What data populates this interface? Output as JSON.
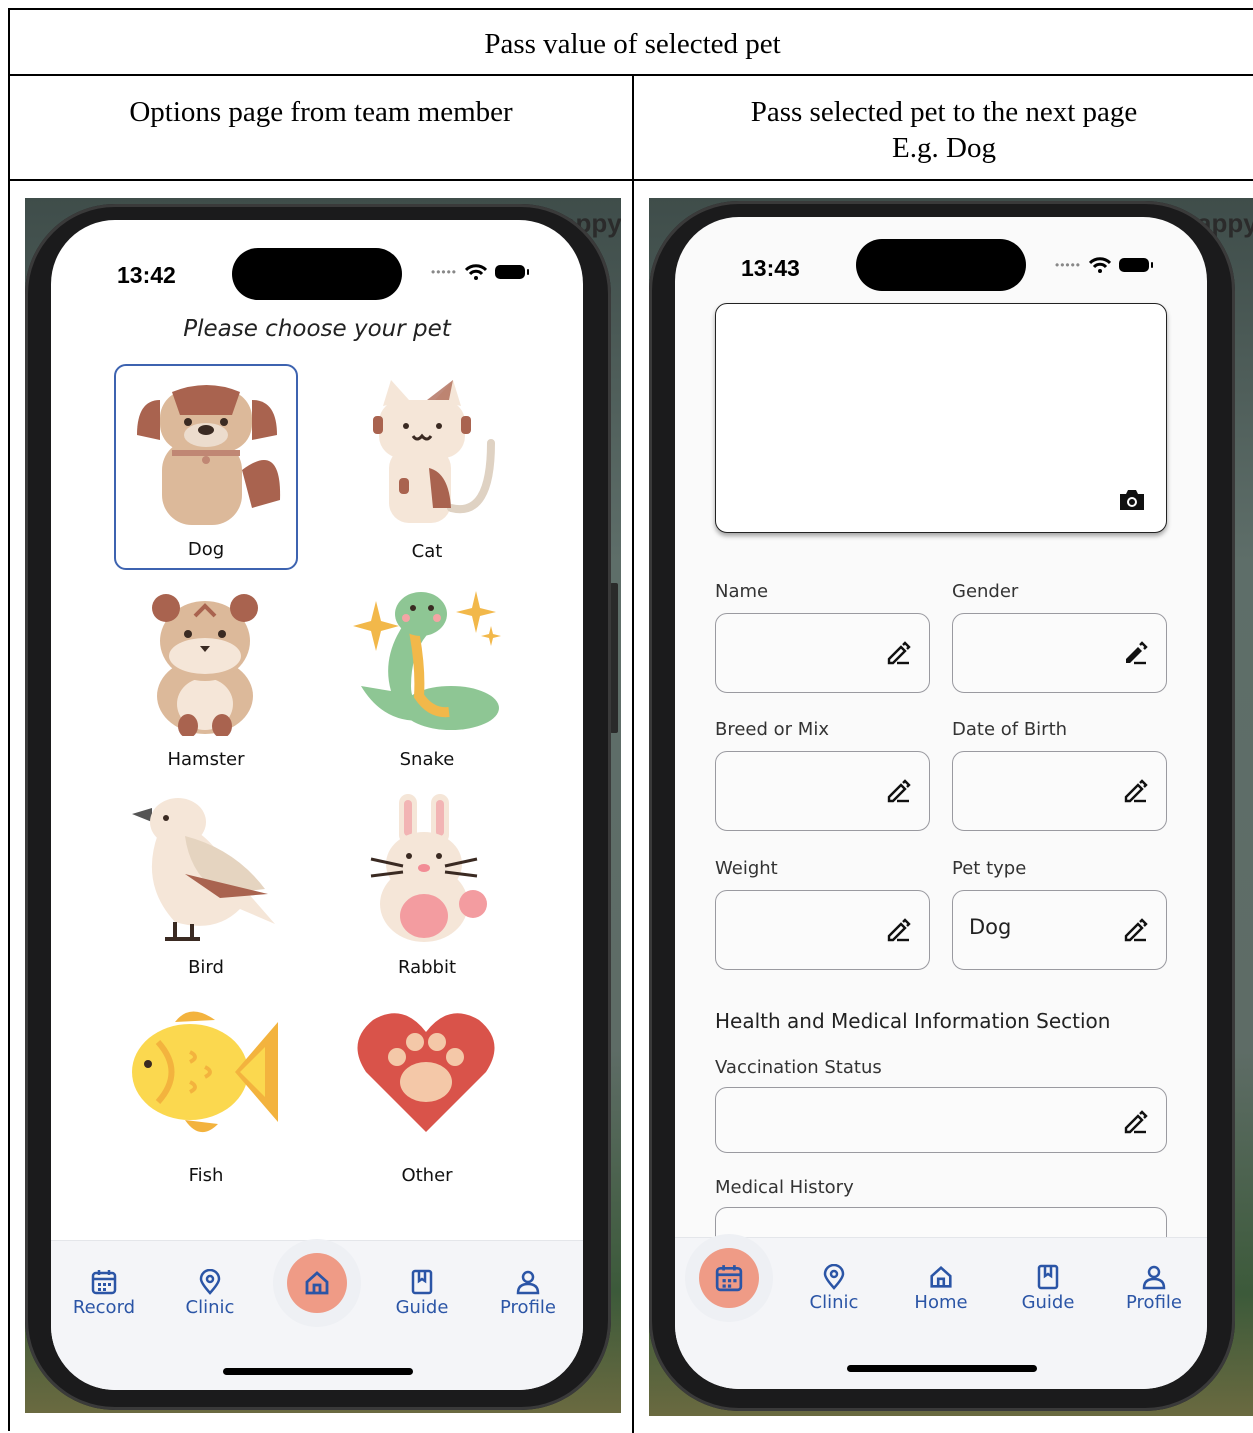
{
  "table": {
    "title": "Pass value of selected pet",
    "left_header": "Options page from team member",
    "right_header_line1": "Pass selected pet to the next page",
    "right_header_line2": "E.g. Dog"
  },
  "left_phone": {
    "time": "13:42",
    "corner_text": "appy",
    "prompt": "Please choose your pet",
    "pets": [
      {
        "label": "Dog",
        "selected": true
      },
      {
        "label": "Cat",
        "selected": false
      },
      {
        "label": "Hamster",
        "selected": false
      },
      {
        "label": "Snake",
        "selected": false
      },
      {
        "label": "Bird",
        "selected": false
      },
      {
        "label": "Rabbit",
        "selected": false
      },
      {
        "label": "Fish",
        "selected": false
      },
      {
        "label": "Other",
        "selected": false
      }
    ],
    "nav": {
      "record": "Record",
      "clinic": "Clinic",
      "guide": "Guide",
      "profile": "Profile"
    }
  },
  "right_phone": {
    "time": "13:43",
    "corner_text": "appy",
    "fields": {
      "name": "Name",
      "gender": "Gender",
      "breed": "Breed or Mix",
      "dob": "Date of Birth",
      "weight": "Weight",
      "pet_type": "Pet type",
      "pet_type_value": "Dog",
      "health_section": "Health and Medical Information Section",
      "vaccination": "Vaccination Status",
      "medical_history": "Medical History"
    },
    "nav": {
      "clinic": "Clinic",
      "home": "Home",
      "guide": "Guide",
      "profile": "Profile"
    }
  },
  "colors": {
    "accent": "#2b55a6",
    "fab": "#ef9b86",
    "selected_border": "#3d63b0"
  }
}
